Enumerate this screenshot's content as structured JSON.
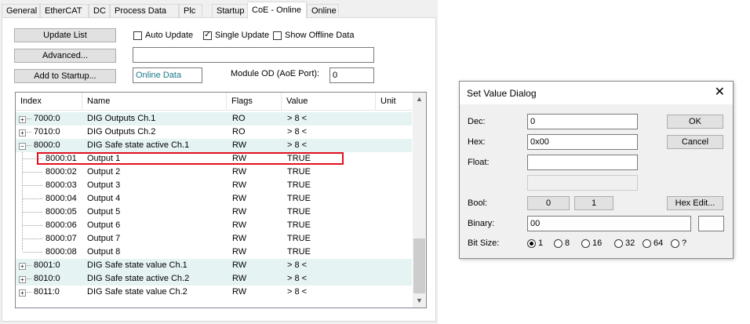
{
  "tabs": [
    "General",
    "EtherCAT",
    "DC",
    "Process Data",
    "Plc",
    "Startup",
    "CoE - Online",
    "Online"
  ],
  "toolbar": {
    "update_list": "Update List",
    "advanced": "Advanced...",
    "add_to_startup": "Add to Startup...",
    "auto_update": "Auto Update",
    "single_update": "Single Update",
    "show_offline": "Show Offline Data",
    "online_data": "Online Data",
    "module_od_label": "Module OD (AoE Port):",
    "module_od_value": "0"
  },
  "list": {
    "columns": [
      "Index",
      "Name",
      "Flags",
      "Value",
      "Unit"
    ],
    "rows": [
      {
        "index": "7000:0",
        "name": "DIG Outputs Ch.1",
        "flags": "RO",
        "value": "> 8 <"
      },
      {
        "index": "7010:0",
        "name": "DIG Outputs Ch.2",
        "flags": "RO",
        "value": "> 8 <"
      },
      {
        "index": "8000:0",
        "name": "DIG Safe state active Ch.1",
        "flags": "RW",
        "value": "> 8 <"
      },
      {
        "index": "8000:01",
        "name": "Output 1",
        "flags": "RW",
        "value": "TRUE"
      },
      {
        "index": "8000:02",
        "name": "Output 2",
        "flags": "RW",
        "value": "TRUE"
      },
      {
        "index": "8000:03",
        "name": "Output 3",
        "flags": "RW",
        "value": "TRUE"
      },
      {
        "index": "8000:04",
        "name": "Output 4",
        "flags": "RW",
        "value": "TRUE"
      },
      {
        "index": "8000:05",
        "name": "Output 5",
        "flags": "RW",
        "value": "TRUE"
      },
      {
        "index": "8000:06",
        "name": "Output 6",
        "flags": "RW",
        "value": "TRUE"
      },
      {
        "index": "8000:07",
        "name": "Output 7",
        "flags": "RW",
        "value": "TRUE"
      },
      {
        "index": "8000:08",
        "name": "Output 8",
        "flags": "RW",
        "value": "TRUE"
      },
      {
        "index": "8001:0",
        "name": "DIG Safe state value Ch.1",
        "flags": "RW",
        "value": "> 8 <"
      },
      {
        "index": "8010:0",
        "name": "DIG Safe state active Ch.2",
        "flags": "RW",
        "value": "> 8 <"
      },
      {
        "index": "8011:0",
        "name": "DIG Safe state value Ch.2",
        "flags": "RW",
        "value": "> 8 <"
      }
    ],
    "expander_symbols": {
      "collapsed": "+",
      "expanded": "−"
    }
  },
  "dialog": {
    "title": "Set Value Dialog",
    "close": "✕",
    "dec_label": "Dec:",
    "dec_value": "0",
    "hex_label": "Hex:",
    "hex_value": "0x00",
    "float_label": "Float:",
    "float_value": "",
    "bool_label": "Bool:",
    "bool_0": "0",
    "bool_1": "1",
    "binary_label": "Binary:",
    "binary_value": "00",
    "bitsize_label": "Bit Size:",
    "bit_sizes": [
      "1",
      "8",
      "16",
      "32",
      "64",
      "?"
    ],
    "ok": "OK",
    "cancel": "Cancel",
    "hex_edit": "Hex Edit..."
  },
  "colors": {
    "highlight_border": "#e3101d",
    "row_shade": "#e6f3f3",
    "online_data_text": "#1a7a8a"
  }
}
